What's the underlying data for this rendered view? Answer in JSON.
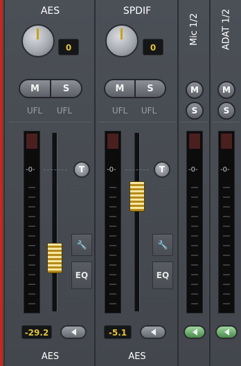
{
  "channels": [
    {
      "name": "AES",
      "gain": "0",
      "mute": "M",
      "solo": "S",
      "ufl_left": "UFL",
      "ufl_right": "UFL",
      "talkback": "T",
      "eq": "EQ",
      "level": "-29.2",
      "output": "AES",
      "fader_level_pct": 20
    },
    {
      "name": "SPDIF",
      "gain": "0",
      "mute": "M",
      "solo": "S",
      "ufl_left": "UFL",
      "ufl_right": "UFL",
      "talkback": "T",
      "eq": "EQ",
      "level": "-5.1",
      "output": "AES",
      "fader_level_pct": 58
    },
    {
      "name": "Mic 1/2",
      "mute": "M",
      "solo": "S"
    },
    {
      "name": "ADAT 1/2",
      "mute": "M",
      "solo": "S"
    }
  ],
  "meter_zero_label": "-0-",
  "colors": {
    "accent": "#c8261f",
    "level_text": "#e3c23a",
    "fader_gold": "#d8b447"
  }
}
